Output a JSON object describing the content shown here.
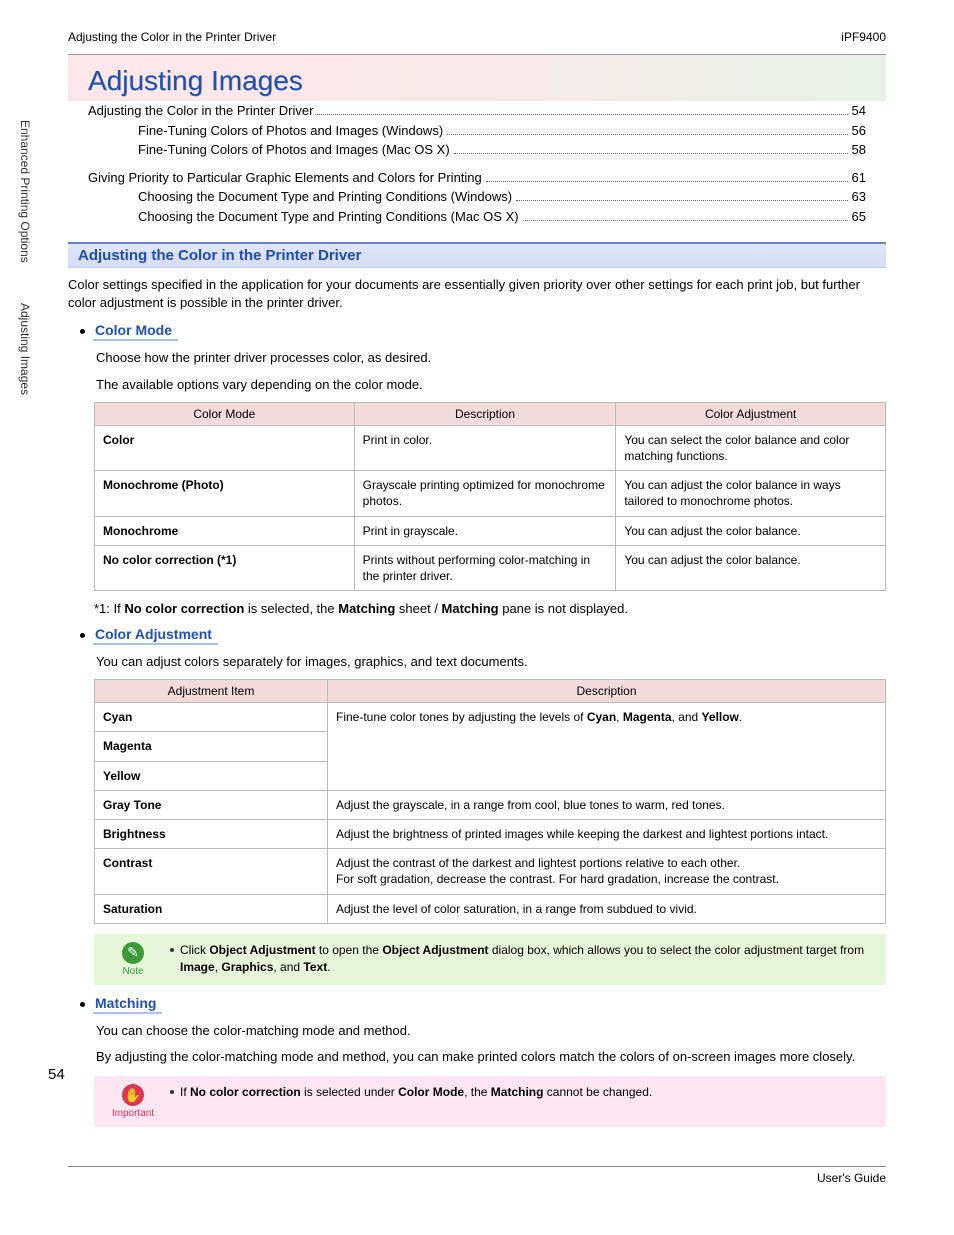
{
  "header": {
    "left": "Adjusting the Color in the Printer Driver",
    "right": "iPF9400"
  },
  "sidebar": {
    "crumb1": "Enhanced Printing Options",
    "crumb2": "Adjusting Images"
  },
  "page_number": "54",
  "chapter_title": "Adjusting Images",
  "toc": {
    "group1": [
      {
        "label": "Adjusting the Color in the Printer Driver",
        "page": "54",
        "sub": false
      },
      {
        "label": "Fine-Tuning Colors of Photos and Images (Windows)",
        "page": "56",
        "sub": true
      },
      {
        "label": "Fine-Tuning Colors of Photos and Images (Mac OS X)",
        "page": "58",
        "sub": true
      }
    ],
    "group2": [
      {
        "label": "Giving Priority to Particular Graphic Elements and Colors for Printing",
        "page": "61",
        "sub": false
      },
      {
        "label": "Choosing the Document Type and Printing Conditions (Windows)",
        "page": "63",
        "sub": true
      },
      {
        "label": "Choosing the Document Type and Printing Conditions (Mac OS X)",
        "page": "65",
        "sub": true
      }
    ]
  },
  "section_title": "Adjusting the Color in the Printer Driver",
  "intro": "Color settings specified in the application for your documents are essentially given priority over other settings for each print job, but further color adjustment is possible in the printer driver.",
  "color_mode": {
    "heading": "Color Mode",
    "p1": "Choose how the printer driver processes color, as desired.",
    "p2": "The available options vary depending on the color mode.",
    "headers": {
      "c1": "Color Mode",
      "c2": "Description",
      "c3": "Color Adjustment"
    },
    "rows": [
      {
        "c1": "Color",
        "c2": "Print in color.",
        "c3": "You can select the color balance and color matching functions."
      },
      {
        "c1": "Monochrome (Photo)",
        "c2": "Grayscale printing optimized for monochrome photos.",
        "c3": "You can adjust the color balance in ways tailored to monochrome photos."
      },
      {
        "c1": "Monochrome",
        "c2": "Print in grayscale.",
        "c3": "You can adjust the color balance."
      },
      {
        "c1": "No color correction (*1)",
        "c2": "Prints without performing color-matching in the printer driver.",
        "c3": "You can adjust the color balance."
      }
    ],
    "footnote_pre": "*1: If ",
    "footnote_b1": "No color correction",
    "footnote_mid1": " is selected, the ",
    "footnote_b2": "Matching",
    "footnote_mid2": " sheet / ",
    "footnote_b3": "Matching",
    "footnote_post": " pane is not displayed."
  },
  "color_adj": {
    "heading": "Color Adjustment",
    "p1": "You can adjust colors separately for images, graphics, and text documents.",
    "headers": {
      "c1": "Adjustment Item",
      "c2": "Description"
    },
    "cmy_pre": "Fine-tune color tones by adjusting the levels of ",
    "cmy_b1": "Cyan",
    "cmy_c1": ", ",
    "cmy_b2": "Magenta",
    "cmy_c2": ", and ",
    "cmy_b3": "Yellow",
    "cmy_post": ".",
    "rows": {
      "cyan": "Cyan",
      "magenta": "Magenta",
      "yellow": "Yellow",
      "gray": {
        "c1": "Gray Tone",
        "c2": "Adjust the grayscale, in a range from cool, blue tones to warm, red tones."
      },
      "bright": {
        "c1": "Brightness",
        "c2": "Adjust the brightness of printed images while keeping the darkest and lightest portions intact."
      },
      "contrast": {
        "c1": "Contrast",
        "c2": "Adjust the contrast of the darkest and lightest portions relative to each other.\nFor soft gradation, decrease the contrast. For hard gradation, increase the contrast."
      },
      "sat": {
        "c1": "Saturation",
        "c2": "Adjust the level of color saturation, in a range from subdued to vivid."
      }
    }
  },
  "note": {
    "label": "Note",
    "pre": "Click ",
    "b1": "Object Adjustment",
    "mid1": " to open the ",
    "b2": "Object Adjustment",
    "mid2": " dialog box, which allows you to select the color adjustment target from ",
    "b3": "Image",
    "c1": ", ",
    "b4": "Graphics",
    "c2": ", and ",
    "b5": "Text",
    "post": "."
  },
  "matching": {
    "heading": "Matching",
    "p1": "You can choose the color-matching mode and method.",
    "p2": "By adjusting the color-matching mode and method, you can make printed colors match the colors of on-screen images more closely."
  },
  "important": {
    "label": "Important",
    "pre": "If ",
    "b1": "No color correction",
    "mid1": " is selected under ",
    "b2": "Color Mode",
    "mid2": ", the ",
    "b3": "Matching",
    "post": " cannot be changed."
  },
  "footer": "User's Guide"
}
